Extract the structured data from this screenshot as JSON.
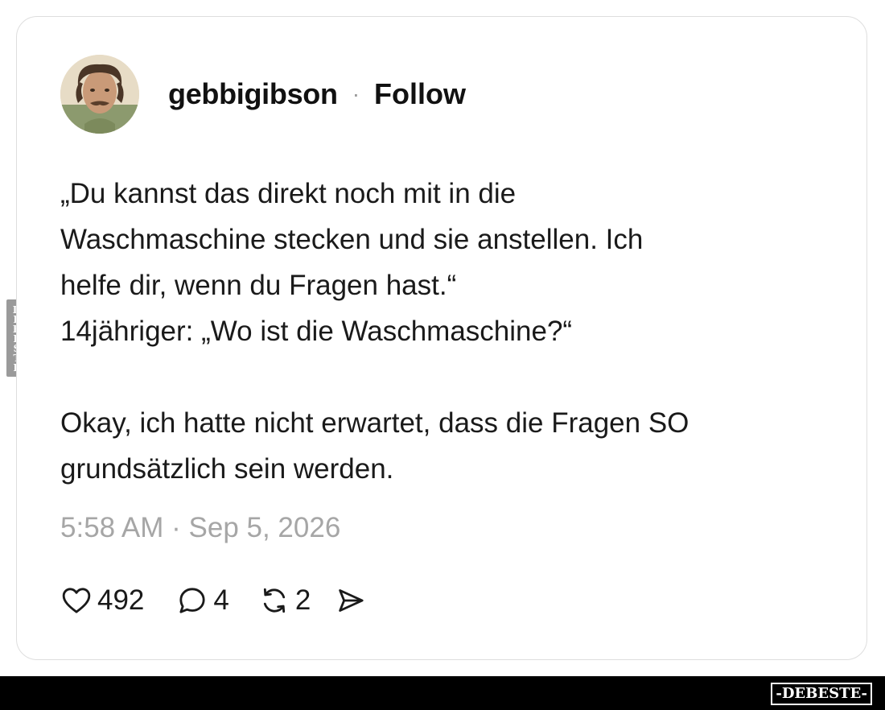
{
  "post": {
    "username": "gebbigibson",
    "separator": "·",
    "follow_label": "Follow",
    "paragraph1": [
      "„Du kannst das direkt noch mit in die",
      "Waschmaschine stecken und sie anstellen. Ich",
      "helfe dir, wenn du Fragen hast.“",
      "14jähriger: „Wo ist die Waschmaschine?“"
    ],
    "paragraph2": [
      "Okay, ich hatte nicht erwartet, dass die Fragen SO",
      "grundsätzlich sein werden."
    ],
    "timestamp": "5:58 AM · Sep 5, 2026",
    "likes": "492",
    "replies": "4",
    "reposts": "2"
  },
  "icons": {
    "like": "heart-icon",
    "reply": "speech-bubble-icon",
    "repost": "repost-arrows-icon",
    "share": "send-icon"
  },
  "watermark": {
    "side_text": "DEBESTE",
    "footer_text": "-DEBESTE-"
  },
  "colors": {
    "text": "#1a1a1a",
    "muted": "#a6a6a6",
    "border": "#dedede",
    "footer": "#000000"
  }
}
